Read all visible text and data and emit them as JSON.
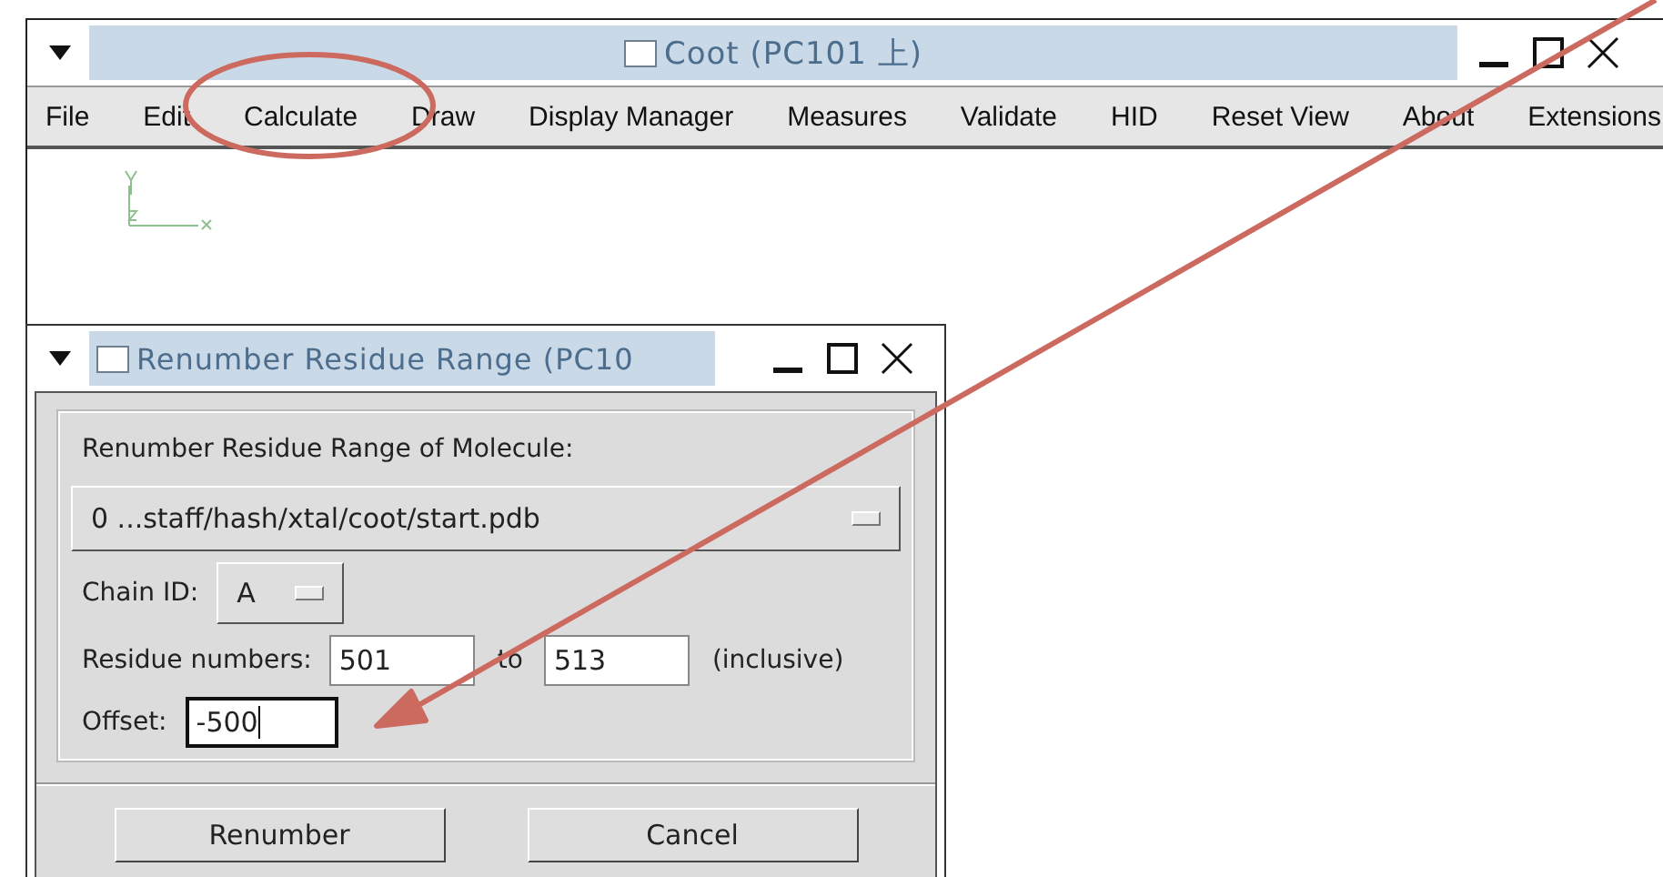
{
  "main_window": {
    "title": "Coot (PC101 上)",
    "menu": [
      "File",
      "Edit",
      "Calculate",
      "Draw",
      "Display Manager",
      "Measures",
      "Validate",
      "HID",
      "Reset View",
      "About",
      "Extensions"
    ]
  },
  "dialog": {
    "title": "Renumber Residue Range (PC10",
    "heading": "Renumber Residue Range of Molecule:",
    "molecule": "0 ...staff/hash/xtal/coot/start.pdb",
    "chain_label": "Chain ID:",
    "chain": "A",
    "residue_label": "Residue numbers:",
    "fields": [
      {
        "value": "501",
        "focused": false
      },
      {
        "value": "513",
        "focused": false
      },
      {
        "value": "-500",
        "focused": true
      }
    ],
    "to_label": "to",
    "inclusive_label": "(inclusive)",
    "offset_label": "Offset:",
    "buttons": [
      "Renumber",
      "Cancel"
    ]
  }
}
